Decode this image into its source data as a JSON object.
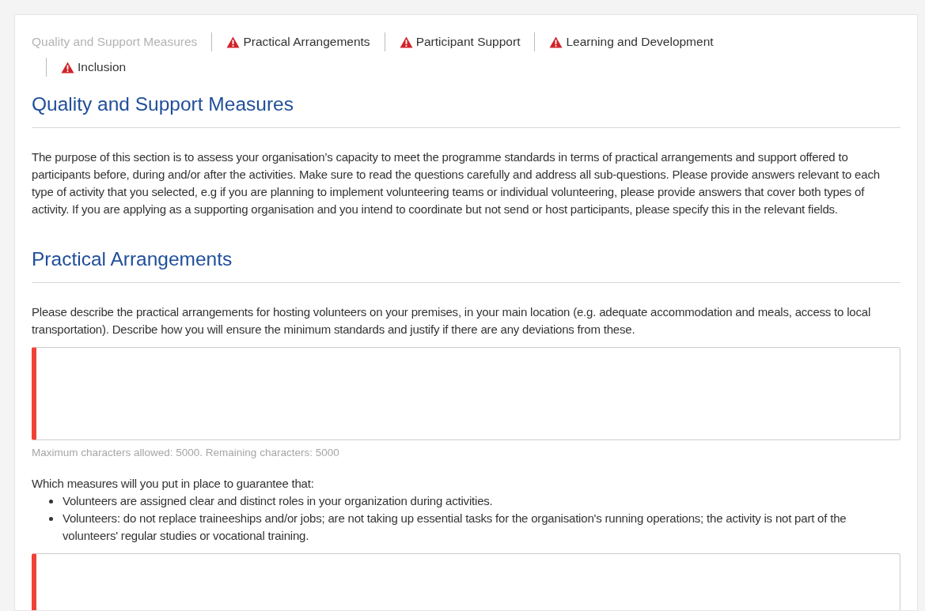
{
  "tabs": [
    {
      "label": "Quality and Support Measures",
      "selected": true,
      "warning": false
    },
    {
      "label": "Practical Arrangements",
      "selected": false,
      "warning": true
    },
    {
      "label": "Participant Support",
      "selected": false,
      "warning": true
    },
    {
      "label": "Learning and Development",
      "selected": false,
      "warning": true
    },
    {
      "label": "Inclusion",
      "selected": false,
      "warning": true
    }
  ],
  "intro": {
    "heading": "Quality and Support Measures",
    "text": "The purpose of this section is to assess your organisation’s capacity to meet the programme standards in terms of practical arrangements and support offered to participants before, during and/or after the activities. Make sure to read the questions carefully and address all sub-questions. Please provide answers relevant to each type of activity that you selected, e.g if you are planning to implement volunteering teams or individual volunteering, please provide answers that cover both types of activity. If you are applying as a supporting organisation and you intend to coordinate but not send or host participants, please specify this in the relevant fields."
  },
  "section": {
    "heading": "Practical Arrangements",
    "questions": [
      {
        "prompt": "Please describe the practical arrangements for hosting volunteers on your premises, in your main location (e.g. adequate accommodation and meals, access to local transportation). Describe how you will ensure the minimum standards and justify if there are any deviations from these.",
        "required": true,
        "counter": "Maximum characters allowed: 5000. Remaining characters: 5000"
      },
      {
        "prompt": "Which measures will you put in place to guarantee that:",
        "bullets": [
          "Volunteers are assigned clear and distinct roles in your organization during activities.",
          "Volunteers: do not replace traineeships and/or jobs; are not taking up essential tasks for the organisation's running operations; the activity is not part of the volunteers' regular studies or vocational training."
        ],
        "required": true
      }
    ]
  }
}
